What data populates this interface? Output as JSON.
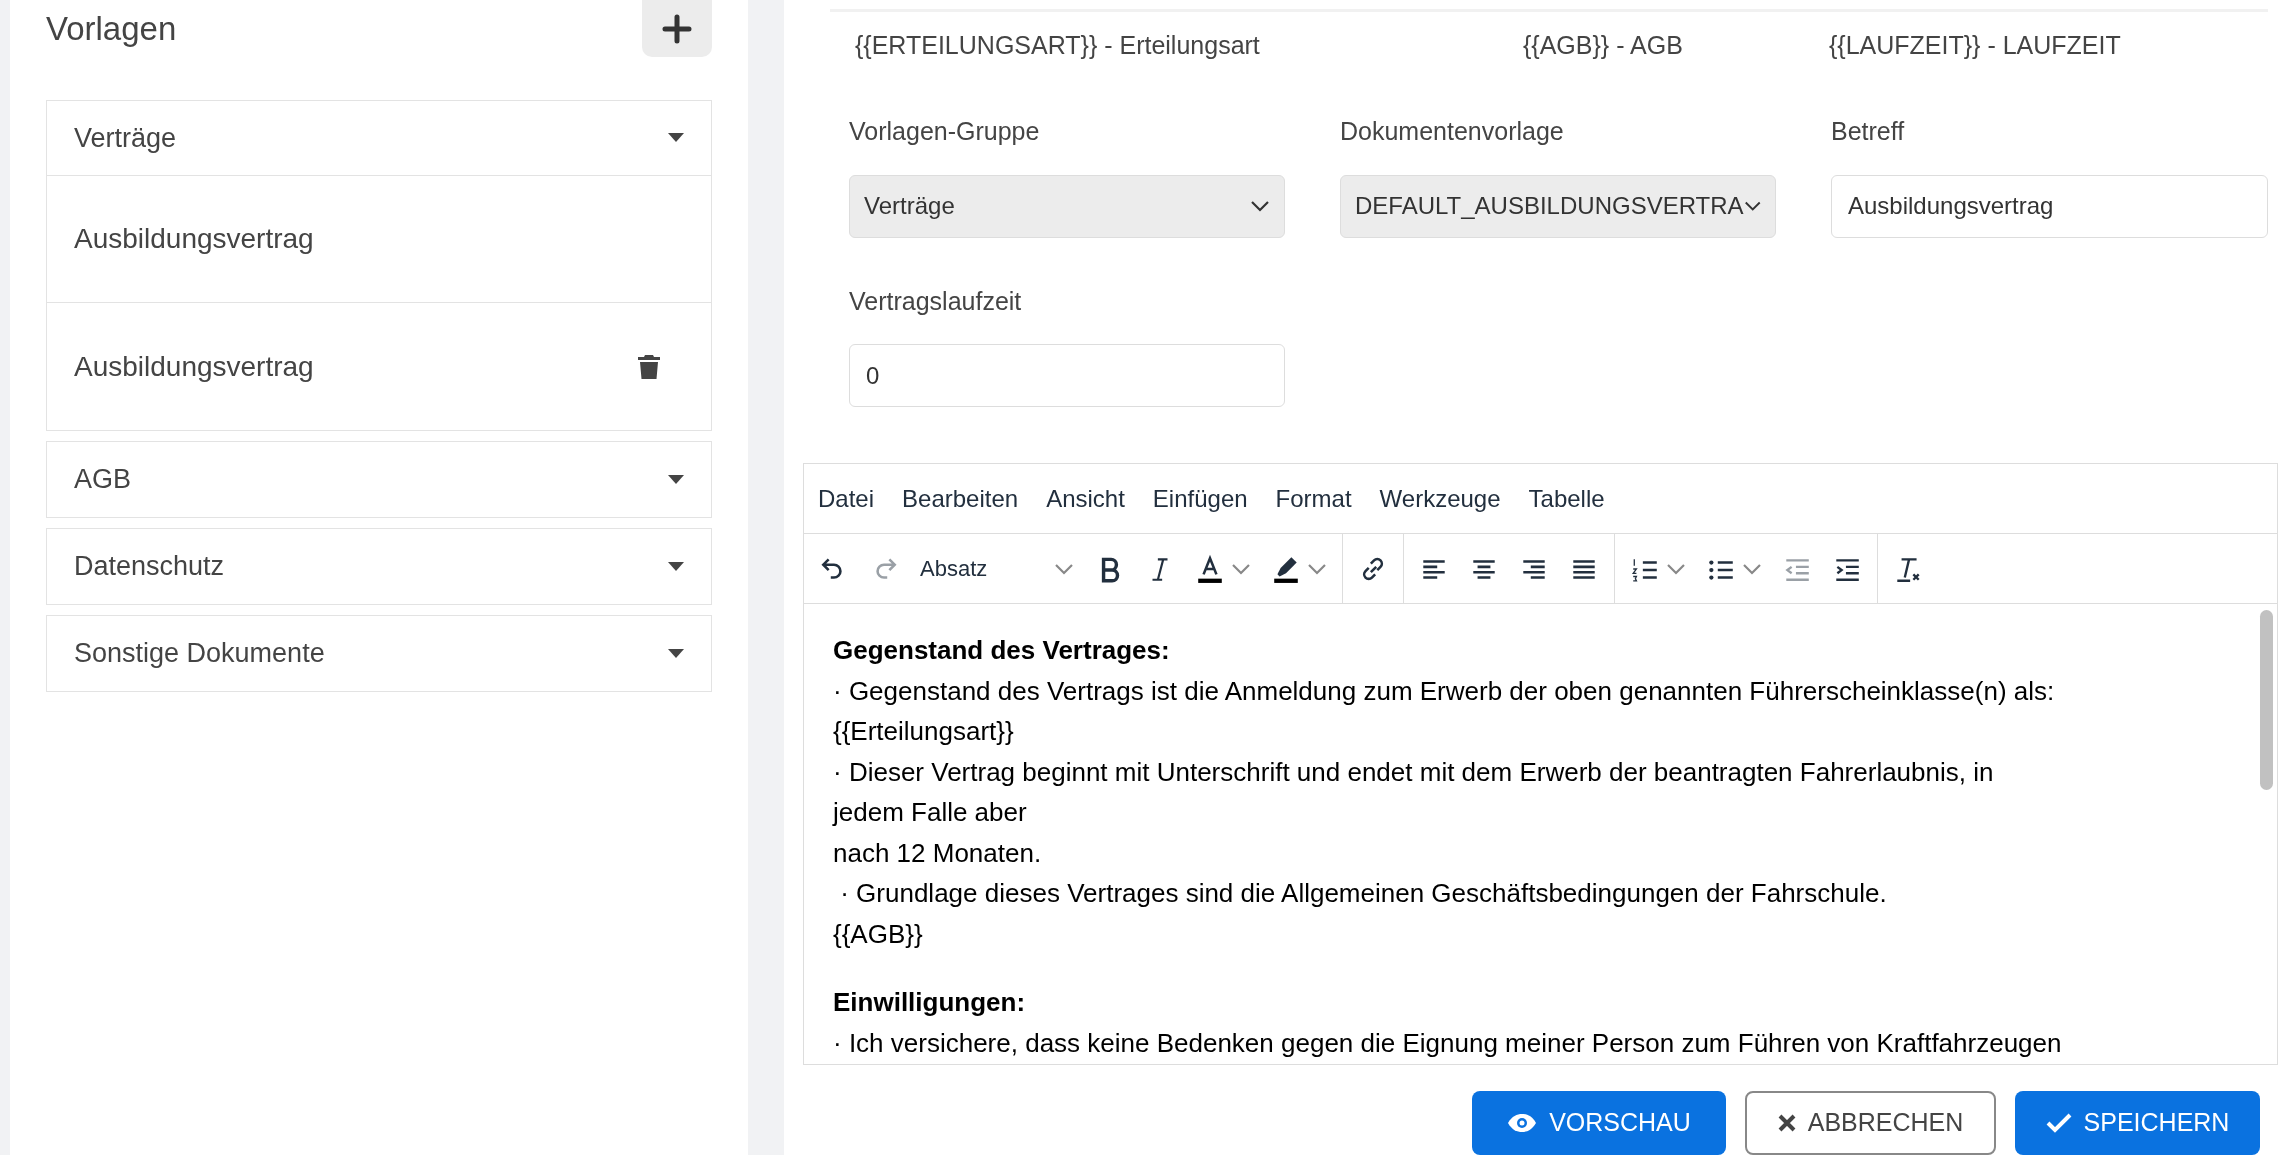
{
  "sidebar": {
    "title": "Vorlagen",
    "groups": [
      {
        "label": "Verträge",
        "expanded": true,
        "items": [
          {
            "label": "Ausbildungsvertrag",
            "deletable": false
          },
          {
            "label": "Ausbildungsvertrag",
            "deletable": true
          }
        ]
      },
      {
        "label": "AGB",
        "expanded": false
      },
      {
        "label": "Datenschutz",
        "expanded": false
      },
      {
        "label": "Sonstige Dokumente",
        "expanded": false
      }
    ]
  },
  "placeholders": [
    "{{ERTEILUNGSART}} - Erteilungsart",
    "{{AGB}} - AGB",
    "{{LAUFZEIT}} - LAUFZEIT"
  ],
  "form": {
    "fields": [
      {
        "label": "Vorlagen-Gruppe",
        "kind": "select",
        "value": "Verträge"
      },
      {
        "label": "Dokumentenvorlage",
        "kind": "select",
        "value": "DEFAULT_AUSBILDUNGSVERTRA"
      },
      {
        "label": "Betreff",
        "kind": "input",
        "value": "Ausbildungsvertrag"
      },
      {
        "label": "Vertragslaufzeit",
        "kind": "input",
        "value": "0"
      }
    ]
  },
  "editor": {
    "menu": [
      "Datei",
      "Bearbeiten",
      "Ansicht",
      "Einfügen",
      "Format",
      "Werkzeuge",
      "Tabelle"
    ],
    "toolbar": [
      [
        {
          "kind": "undo",
          "disabled": false
        },
        {
          "kind": "redo",
          "disabled": true
        },
        {
          "kind": "block-format",
          "label": "Absatz",
          "disabled": false
        },
        {
          "kind": "bold",
          "disabled": false
        },
        {
          "kind": "italic",
          "disabled": false
        },
        {
          "kind": "text-color",
          "disabled": false
        },
        {
          "kind": "highlight",
          "disabled": false
        }
      ],
      [
        {
          "kind": "link",
          "disabled": false
        }
      ],
      [
        {
          "kind": "align-left",
          "disabled": false
        },
        {
          "kind": "align-center",
          "disabled": false
        },
        {
          "kind": "align-right",
          "disabled": false
        },
        {
          "kind": "justify",
          "disabled": false
        }
      ],
      [
        {
          "kind": "numbered-list",
          "disabled": false
        },
        {
          "kind": "bullet-list",
          "disabled": false
        },
        {
          "kind": "outdent",
          "disabled": true
        },
        {
          "kind": "indent",
          "disabled": false
        }
      ],
      [
        {
          "kind": "clear-format",
          "disabled": false
        }
      ]
    ],
    "content": [
      {
        "kind": "heading",
        "text": "Gegenstand des Vertrages:"
      },
      {
        "kind": "line",
        "text": "· Gegenstand des Vertrags ist die Anmeldung zum Erwerb der oben genannten Führerscheinklasse(n) als:"
      },
      {
        "kind": "line",
        "text": "{{Erteilungsart}}"
      },
      {
        "kind": "line",
        "text": "· Dieser Vertrag beginnt mit Unterschrift und endet mit dem Erwerb der beantragten Fahrerlaubnis, in"
      },
      {
        "kind": "line",
        "text": "jedem Falle aber"
      },
      {
        "kind": "line",
        "text": "nach 12 Monaten."
      },
      {
        "kind": "line",
        "text": " · Grundlage dieses Vertrages sind die Allgemeinen Geschäftsbedingungen der Fahrschule."
      },
      {
        "kind": "line",
        "text": "{{AGB}}"
      },
      {
        "kind": "heading",
        "text": "Einwilligungen:"
      },
      {
        "kind": "line",
        "text": "· Ich versichere, dass keine Bedenken gegen die Eignung meiner Person zum Führen von Kraftfahrzeugen"
      }
    ]
  },
  "buttons": [
    {
      "label": "VORSCHAU",
      "kind": "preview"
    },
    {
      "label": "ABBRECHEN",
      "kind": "cancel"
    },
    {
      "label": "SPEICHERN",
      "kind": "save"
    }
  ]
}
